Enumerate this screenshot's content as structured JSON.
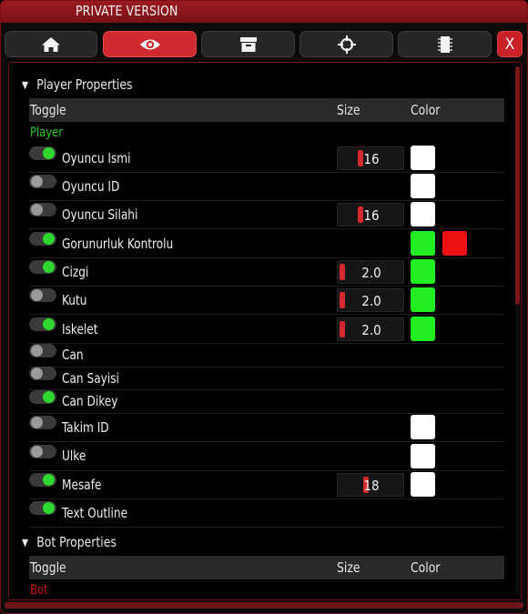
{
  "window": {
    "title": "PRIVATE VERSION",
    "close_label": "X"
  },
  "tabs": [
    {
      "icon": "home-icon",
      "active": false
    },
    {
      "icon": "eye-icon",
      "active": true
    },
    {
      "icon": "archive-icon",
      "active": false
    },
    {
      "icon": "crosshair-icon",
      "active": false
    },
    {
      "icon": "chip-icon",
      "active": false
    }
  ],
  "player_section": {
    "title": "Player Properties",
    "columns": {
      "toggle": "Toggle",
      "size": "Size",
      "color": "Color"
    },
    "group_label": "Player",
    "group_color": "#22cc22",
    "rows": [
      {
        "label": "Oyuncu Ismi",
        "on": true,
        "size": "16",
        "size_fraction": 0.31,
        "colors": [
          "#ffffff"
        ]
      },
      {
        "label": "Oyuncu ID",
        "on": false,
        "size": null,
        "colors": [
          "#ffffff"
        ]
      },
      {
        "label": "Oyuncu Silahi",
        "on": false,
        "size": "16",
        "size_fraction": 0.31,
        "colors": [
          "#ffffff"
        ]
      },
      {
        "label": "Gorunurluk Kontrolu",
        "on": true,
        "size": null,
        "colors": [
          "#22ee22",
          "#ee1111"
        ]
      },
      {
        "label": "Cizgi",
        "on": true,
        "size": "2.0",
        "size_fraction": 0.0,
        "colors": [
          "#22ee22"
        ]
      },
      {
        "label": "Kutu",
        "on": false,
        "size": "2.0",
        "size_fraction": 0.0,
        "colors": [
          "#22ee22"
        ]
      },
      {
        "label": "Iskelet",
        "on": true,
        "size": "2.0",
        "size_fraction": 0.0,
        "colors": [
          "#22ee22"
        ]
      },
      {
        "label": "Can",
        "on": false,
        "size": null,
        "colors": []
      },
      {
        "label": "Can Sayisi",
        "on": false,
        "size": null,
        "colors": []
      },
      {
        "label": "Can Dikey",
        "on": true,
        "size": null,
        "colors": []
      },
      {
        "label": "Takim ID",
        "on": false,
        "size": null,
        "colors": [
          "#ffffff"
        ]
      },
      {
        "label": "Ulke",
        "on": false,
        "size": null,
        "colors": [
          "#ffffff"
        ]
      },
      {
        "label": "Mesafe",
        "on": true,
        "size": "18",
        "size_fraction": 0.4,
        "colors": [
          "#ffffff"
        ]
      },
      {
        "label": "Text Outline",
        "on": true,
        "size": null,
        "colors": []
      }
    ]
  },
  "bot_section": {
    "title": "Bot Properties",
    "columns": {
      "toggle": "Toggle",
      "size": "Size",
      "color": "Color"
    },
    "group_label": "Bot",
    "group_color": "#cc1111"
  }
}
